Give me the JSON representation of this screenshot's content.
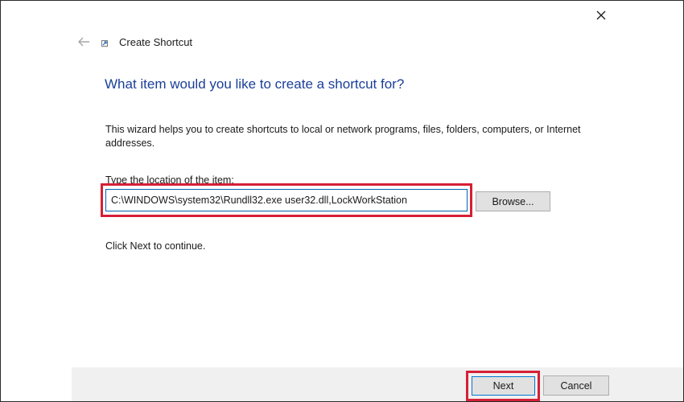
{
  "window": {
    "title": "Create Shortcut",
    "close_icon": "close-icon",
    "back_icon": "back-arrow-icon",
    "app_icon": "shortcut-icon"
  },
  "main": {
    "heading": "What item would you like to create a shortcut for?",
    "description": "This wizard helps you to create shortcuts to local or network programs, files, folders, computers, or Internet addresses.",
    "field_label": "Type the location of the item:",
    "location_value": "C:\\WINDOWS\\system32\\Rundll32.exe user32.dll,LockWorkStation",
    "browse_label": "Browse...",
    "continue_text": "Click Next to continue."
  },
  "footer": {
    "next_label": "Next",
    "cancel_label": "Cancel"
  },
  "colors": {
    "heading": "#1a3f99",
    "highlight": "#d61f36",
    "focus_border": "#0078d7",
    "footer_bg": "#f0f0f0"
  }
}
